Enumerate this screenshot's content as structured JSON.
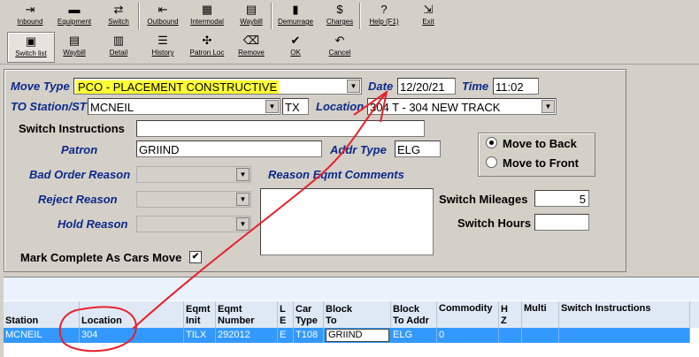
{
  "toolbar1": [
    {
      "label": "Inbound",
      "icon": "inbound-icon",
      "glyph": "⇥"
    },
    {
      "label": "Equipment",
      "icon": "equipment-icon",
      "glyph": "▬"
    },
    {
      "label": "Switch",
      "icon": "switch-icon",
      "glyph": "⇄"
    },
    {
      "label": "Outbound",
      "icon": "outbound-icon",
      "glyph": "⇤"
    },
    {
      "label": "Intermodal",
      "icon": "intermodal-icon",
      "glyph": "▦"
    },
    {
      "label": "Waybill",
      "icon": "waybill-icon",
      "glyph": "▤"
    },
    {
      "label": "Demurrage",
      "icon": "demurrage-icon",
      "glyph": "▮"
    },
    {
      "label": "Charges",
      "icon": "charges-icon",
      "glyph": "$"
    },
    {
      "label": "Help (F1)",
      "icon": "help-icon",
      "glyph": "?"
    },
    {
      "label": "Exit",
      "icon": "exit-icon",
      "glyph": "⇲"
    }
  ],
  "toolbar2": [
    {
      "label": "Switch list",
      "icon": "printer-icon",
      "glyph": "▣"
    },
    {
      "label": "Waybill",
      "icon": "waybill-doc-icon",
      "glyph": "▤"
    },
    {
      "label": "Detail",
      "icon": "detail-icon",
      "glyph": "▥"
    },
    {
      "label": "History",
      "icon": "history-icon",
      "glyph": "☰"
    },
    {
      "label": "Patron Loc",
      "icon": "patron-loc-icon",
      "glyph": "✣"
    },
    {
      "label": "Remove",
      "icon": "remove-icon",
      "glyph": "⌫"
    },
    {
      "label": "OK",
      "icon": "ok-check-icon",
      "glyph": "✔"
    },
    {
      "label": "Cancel",
      "icon": "cancel-icon",
      "glyph": "↶"
    }
  ],
  "colors": {
    "label_blue": "#0c2a8a",
    "highlight": "#ffff33",
    "selection": "#3399ff",
    "annotation": "#e8202a"
  },
  "form": {
    "move_type_label": "Move Type",
    "move_type_value": "PCO - PLACEMENT CONSTRUCTIVE",
    "date_label": "Date",
    "date_value": "12/20/21",
    "time_label": "Time",
    "time_value": "11:02",
    "to_station_label": "TO Station/ST",
    "to_station_value": "MCNEIL",
    "state_value": "TX",
    "location_label": "Location",
    "location_value": "304 T - 304 NEW TRACK",
    "switch_instructions_label": "Switch Instructions",
    "switch_instructions_value": "",
    "patron_label": "Patron",
    "patron_value": "GRIIND",
    "addr_type_label": "Addr Type",
    "addr_type_value": "ELG",
    "move_to_back": "Move to Back",
    "move_to_front": "Move to Front",
    "bad_order_label": "Bad Order Reason",
    "reason_comments_label": "Reason Eqmt Comments",
    "reject_label": "Reject Reason",
    "switch_mileages_label": "Switch Mileages",
    "switch_mileages_value": "5",
    "hold_label": "Hold Reason",
    "switch_hours_label": "Switch Hours",
    "switch_hours_value": "",
    "mark_complete_label": "Mark Complete As Cars Move",
    "mark_complete_checked": "✔"
  },
  "grid": {
    "headers": [
      "Station",
      "Location",
      "Eqmt Init",
      "Eqmt Number",
      "L E",
      "Car Type",
      "Block To",
      "Block To Addr",
      "Commodity",
      "H Z",
      "Multi",
      "Switch Instructions"
    ],
    "row": [
      "MCNEIL",
      "304",
      "TILX",
      "292012",
      "E",
      "T108",
      "GRIIND",
      "ELG",
      "0",
      "",
      "",
      ""
    ]
  }
}
